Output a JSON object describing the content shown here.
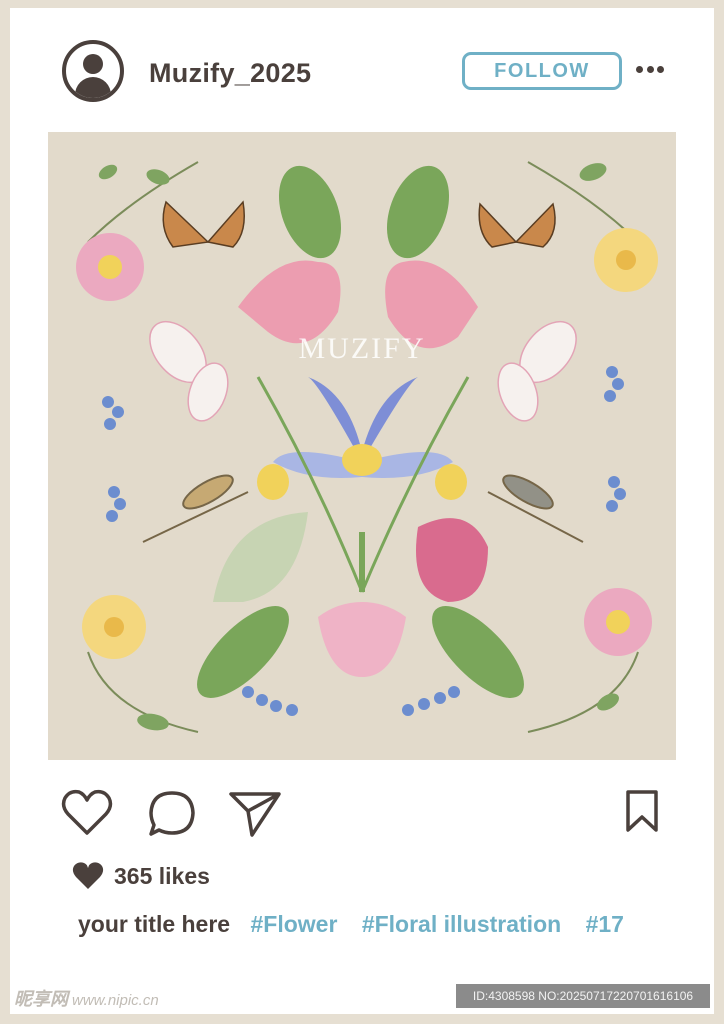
{
  "post": {
    "username": "Muzify_2025",
    "follow_label": "FOLLOW",
    "image_watermark": "MUZIFY",
    "likes_text": "365 likes",
    "caption_title": "your title here",
    "hashtags": [
      "#Flower",
      "#Floral illustration",
      "#17"
    ]
  },
  "footer": {
    "site_name": "昵享网",
    "site_url": "www.nipic.cn",
    "id_text": "ID:4308598 NO:20250717220701616106"
  },
  "icons": {
    "avatar": "user-avatar-icon",
    "more": "more-dots-icon",
    "like": "heart-outline-icon",
    "comment": "comment-bubble-icon",
    "share": "paper-plane-icon",
    "bookmark": "bookmark-icon",
    "likes": "heart-filled-icon"
  },
  "colors": {
    "text_dark": "#4a403c",
    "accent": "#6fb0c6",
    "image_background": "#e2dacb",
    "page_background": "#e6dfd2"
  }
}
